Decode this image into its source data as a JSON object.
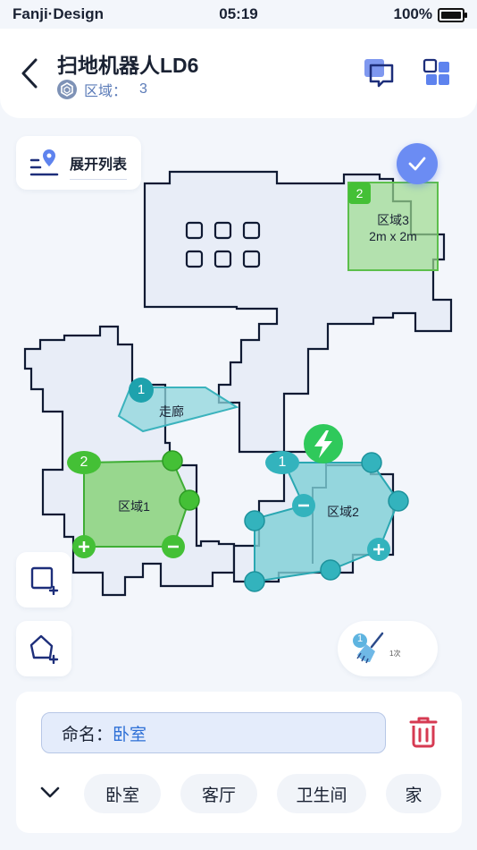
{
  "status_bar": {
    "carrier": "Fanji·Design",
    "time": "05:19",
    "battery": "100%"
  },
  "header": {
    "title": "扫地机器人LD6",
    "subtitle_label": "区域：",
    "subtitle_count": "3"
  },
  "list_toggle": {
    "label": "展开列表"
  },
  "map": {
    "zones": [
      {
        "name": "走廊",
        "badge": "1"
      },
      {
        "name": "区域1",
        "badge": "2"
      },
      {
        "name": "区域2",
        "badge": "1"
      },
      {
        "name": "区域3",
        "badge": "2",
        "size": "2m x 2m"
      }
    ]
  },
  "clean": {
    "count": "1",
    "times": "1次"
  },
  "panel": {
    "name_label": "命名：",
    "name_value": "卧室",
    "chips": [
      "卧室",
      "客厅",
      "卫生间",
      "家"
    ]
  },
  "colors": {
    "accent": "#6b8cf3",
    "green_zone": "#8fd482",
    "teal_zone": "#7ed0d6",
    "danger": "#d63a52"
  }
}
